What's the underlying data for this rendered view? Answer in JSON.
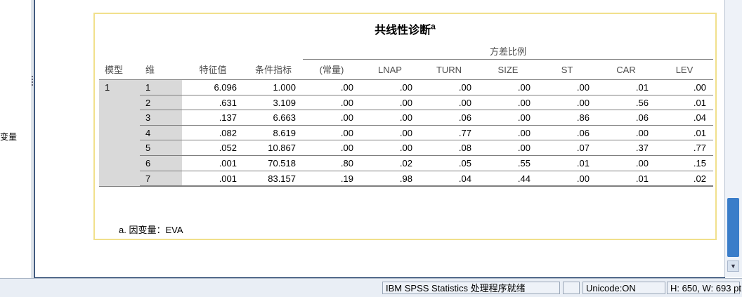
{
  "left_pane": {
    "label": "变量"
  },
  "table": {
    "title": "共线性诊断",
    "title_footnote_mark": "a",
    "group_header": "方差比例",
    "column_headers": [
      "模型",
      "维",
      "特征值",
      "条件指标",
      "(常量)",
      "LNAP",
      "TURN",
      "SIZE",
      "ST",
      "CAR",
      "LEV"
    ],
    "model_label": "1",
    "rows": [
      [
        "1",
        "6.096",
        "1.000",
        ".00",
        ".00",
        ".00",
        ".00",
        ".00",
        ".01",
        ".00"
      ],
      [
        "2",
        ".631",
        "3.109",
        ".00",
        ".00",
        ".00",
        ".00",
        ".00",
        ".56",
        ".01"
      ],
      [
        "3",
        ".137",
        "6.663",
        ".00",
        ".00",
        ".06",
        ".00",
        ".86",
        ".06",
        ".04"
      ],
      [
        "4",
        ".082",
        "8.619",
        ".00",
        ".00",
        ".77",
        ".00",
        ".06",
        ".00",
        ".01"
      ],
      [
        "5",
        ".052",
        "10.867",
        ".00",
        ".00",
        ".08",
        ".00",
        ".07",
        ".37",
        ".77"
      ],
      [
        "6",
        ".001",
        "70.518",
        ".80",
        ".02",
        ".05",
        ".55",
        ".01",
        ".00",
        ".15"
      ],
      [
        "7",
        ".001",
        "83.157",
        ".19",
        ".98",
        ".04",
        ".44",
        ".00",
        ".01",
        ".02"
      ]
    ],
    "footnote": "a. 因变量：EVA"
  },
  "statusbar": {
    "processor": "IBM SPSS Statistics 处理程序就绪",
    "unicode": "Unicode:ON",
    "size": "H: 650, W: 693 pt."
  }
}
